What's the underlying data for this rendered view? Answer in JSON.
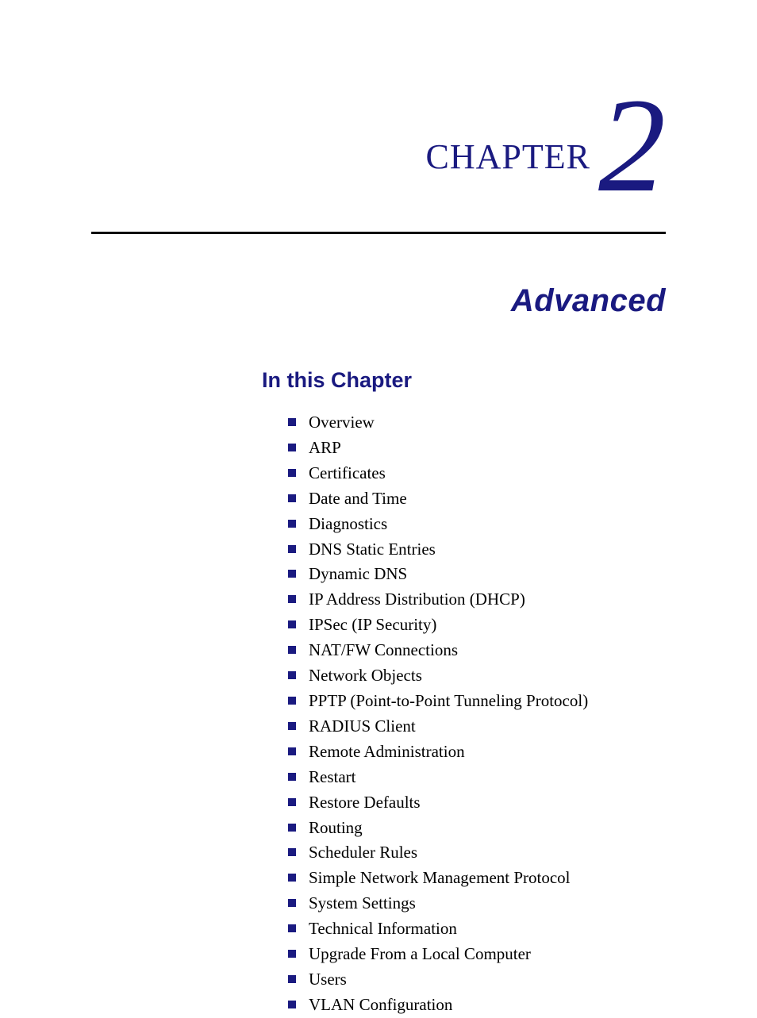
{
  "chapter": {
    "label": "CHAPTER",
    "number": "2",
    "title": "Advanced"
  },
  "section_heading": "In this Chapter",
  "toc_items": [
    "Overview",
    "ARP",
    "Certificates",
    "Date and Time",
    "Diagnostics",
    "DNS Static Entries",
    "Dynamic DNS",
    "IP Address Distribution (DHCP)",
    "IPSec (IP Security)",
    "NAT/FW Connections",
    "Network Objects",
    "PPTP (Point-to-Point Tunneling Protocol)",
    "RADIUS Client",
    "Remote Administration",
    "Restart",
    "Restore Defaults",
    "Routing",
    "Scheduler Rules",
    "Simple Network Management Protocol",
    "System Settings",
    "Technical Information",
    "Upgrade From a Local Computer",
    "Users",
    "VLAN Configuration"
  ]
}
